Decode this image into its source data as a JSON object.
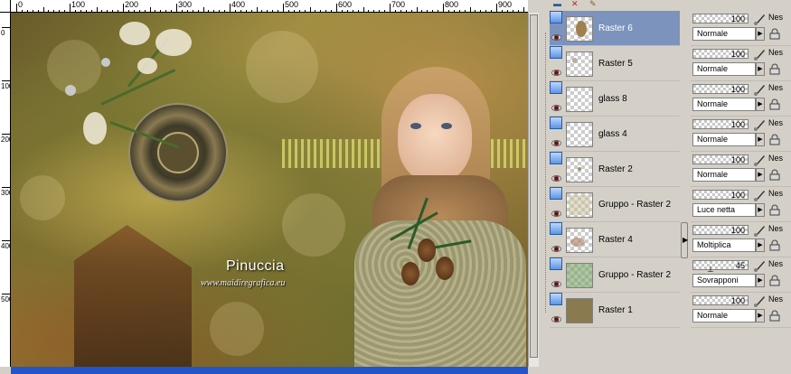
{
  "ruler": {
    "h_ticks": [
      "0",
      "100",
      "200",
      "300",
      "400",
      "500",
      "600",
      "700",
      "800",
      "900"
    ],
    "v_ticks": [
      "0",
      "100",
      "200",
      "300",
      "400",
      "500"
    ]
  },
  "canvas": {
    "watermark_name": "Pinuccia",
    "watermark_url": "www.maidiregrafica.eu"
  },
  "toolbar": {
    "icons": [
      "new-layer-icon",
      "delete-layer-icon",
      "edit-icon"
    ]
  },
  "layers": [
    {
      "name": "Raster 6",
      "selected": true,
      "opacity": 100,
      "opacity_text": "100",
      "blend": "Normale",
      "suffix": "Nes"
    },
    {
      "name": "Raster 5",
      "selected": false,
      "opacity": 100,
      "opacity_text": "100",
      "blend": "Normale",
      "suffix": "Nes"
    },
    {
      "name": "glass 8",
      "selected": false,
      "opacity": 100,
      "opacity_text": "100",
      "blend": "Normale",
      "suffix": "Nes"
    },
    {
      "name": "glass 4",
      "selected": false,
      "opacity": 100,
      "opacity_text": "100",
      "blend": "Normale",
      "suffix": "Nes"
    },
    {
      "name": "Raster 2",
      "selected": false,
      "opacity": 100,
      "opacity_text": "100",
      "blend": "Normale",
      "suffix": "Nes"
    },
    {
      "name": "Gruppo - Raster 2",
      "selected": false,
      "opacity": 100,
      "opacity_text": "100",
      "blend": "Luce netta",
      "suffix": "Nes"
    },
    {
      "name": "Raster 4",
      "selected": false,
      "opacity": 100,
      "opacity_text": "100",
      "blend": "Moltiplica",
      "suffix": "Nes"
    },
    {
      "name": "Gruppo - Raster 2",
      "selected": false,
      "opacity": 45,
      "opacity_text": "45",
      "blend": "Sovrapponi",
      "suffix": "Nes"
    },
    {
      "name": "Raster 1",
      "selected": false,
      "opacity": 100,
      "opacity_text": "100",
      "blend": "Normale",
      "suffix": "Nes"
    }
  ],
  "colors": {
    "selection": "#7b93bd",
    "panel": "#d4d0c8",
    "scroll_accent": "#2255cc"
  }
}
